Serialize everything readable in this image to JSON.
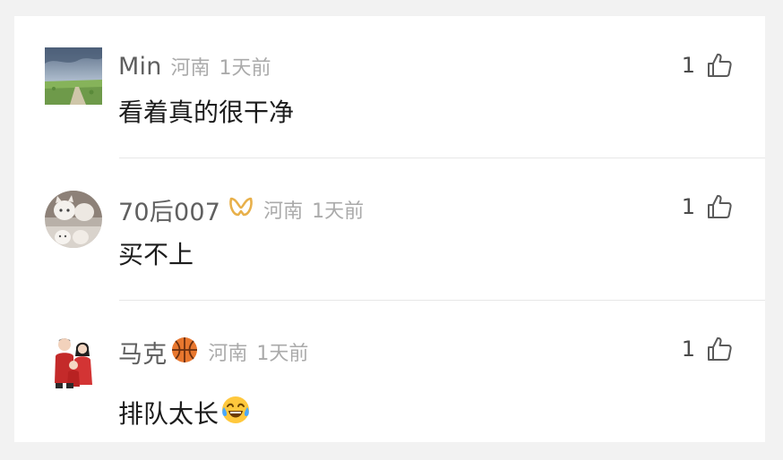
{
  "comments": [
    {
      "username": "Min",
      "location": "河南",
      "time": "1天前",
      "text": "看着真的很干净",
      "likes": "1",
      "avatar": "landscape-avatar"
    },
    {
      "username": "70后007",
      "location": "河南",
      "time": "1天前",
      "text": "买不上",
      "likes": "1",
      "avatar": "cat-avatar",
      "badge": "gold-ribbon-icon"
    },
    {
      "username": "马克",
      "location": "河南",
      "time": "1天前",
      "text": "排队太长",
      "likes": "1",
      "avatar": "family-avatar",
      "badge": "basketball-icon",
      "text_emoji": "crying-laughing-emoji"
    }
  ],
  "colors": {
    "username": "#5f5f5f",
    "meta": "#aaaaaa",
    "text": "#1c1c1c",
    "divider": "#e7e7e7",
    "background": "#f2f2f2"
  }
}
